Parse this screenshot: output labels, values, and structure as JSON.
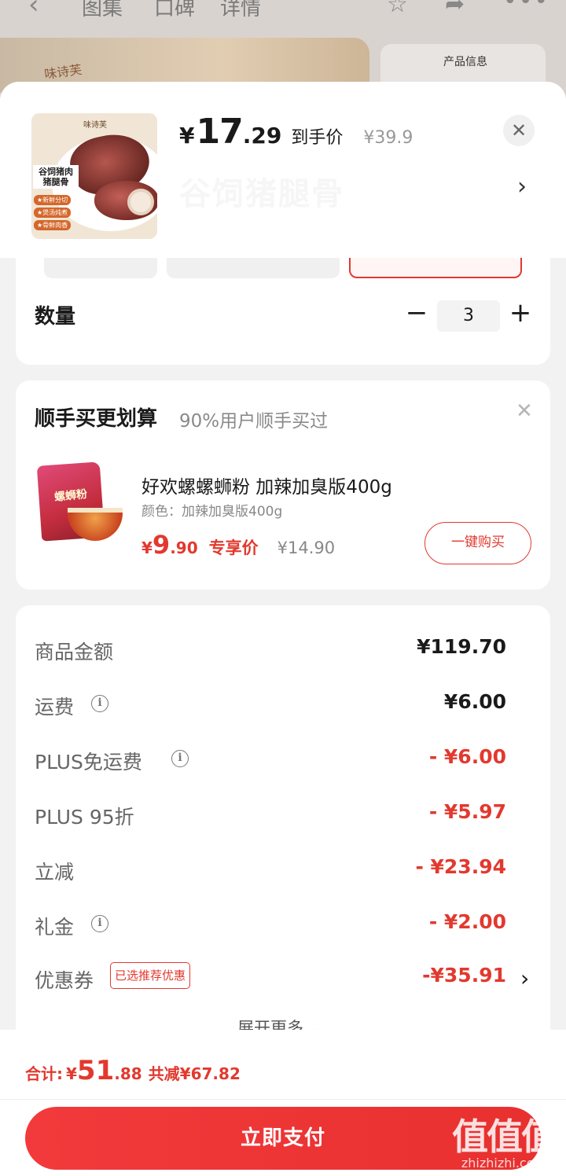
{
  "background": {
    "tabs": [
      "图集",
      "口碑",
      "详情"
    ],
    "product_info_caption": "产品信息",
    "brand": "味诗芙"
  },
  "product": {
    "thumbnail_title": "谷饲猪肉 猪腿骨",
    "thumbnail_tags": [
      "★新鲜分切",
      "★煲汤炖煮",
      "★骨鲜肉香"
    ],
    "price_currency": "¥",
    "price_integer": "17",
    "price_decimal": ".29",
    "price_label": "到手价",
    "original_price": "¥39.9",
    "selected_spec": "谷饲猪腿骨"
  },
  "quantity": {
    "label": "数量",
    "value": "3",
    "minus": "−",
    "plus": "+"
  },
  "addon": {
    "title": "顺手买更划算",
    "subtitle": "90%用户顺手买过",
    "item_name": "好欢螺螺蛳粉 加辣加臭版400g",
    "item_color": "颜色：加辣加臭版400g",
    "price_currency": "¥",
    "price_integer": "9",
    "price_decimal": ".90",
    "price_label": "专享价",
    "original_price": "¥14.90",
    "bag_text": "螺蛳粉",
    "buy_button": "一键购买"
  },
  "costs": {
    "rows": [
      {
        "label": "商品金额",
        "value": "¥119.70",
        "info": false,
        "red": false
      },
      {
        "label": "运费",
        "value": "¥6.00",
        "info": true,
        "red": false
      },
      {
        "label": "PLUS免运费",
        "value": "- ¥6.00",
        "info": true,
        "red": true
      },
      {
        "label": "PLUS 95折",
        "value": "- ¥5.97",
        "info": false,
        "red": true
      },
      {
        "label": "立减",
        "value": "- ¥23.94",
        "info": false,
        "red": true
      },
      {
        "label": "礼金",
        "value": "- ¥2.00",
        "info": true,
        "red": true
      },
      {
        "label": "优惠券",
        "value": "-¥35.91",
        "info": false,
        "red": true
      }
    ],
    "coupon_tag": "已选推荐优惠",
    "expand_more": "展开更多 ⌄"
  },
  "footer": {
    "total_label": "合计:",
    "total_currency": "¥",
    "total_integer": "51",
    "total_decimal": ".88",
    "total_saved": "共减¥67.82",
    "pay_button": "立即支付"
  },
  "watermark": {
    "logo": "值值值",
    "site": "zhizhizhi.com"
  },
  "colors": {
    "accent_red": "#e2392f",
    "pay_gradient_start": "#f23a3c",
    "pay_gradient_end": "#e8302f"
  }
}
